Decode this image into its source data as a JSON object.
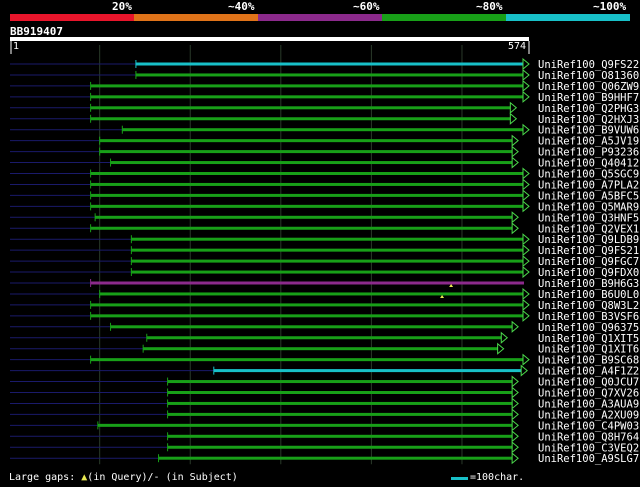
{
  "query": {
    "id": "BB919407",
    "start": "1",
    "end": "574",
    "length": 574
  },
  "identity_legend": [
    {
      "label": "20%",
      "color": "#e8152b"
    },
    {
      "label": "~40%",
      "color": "#e07319"
    },
    {
      "label": "~60%",
      "color": "#8c2a8c"
    },
    {
      "label": "~80%",
      "color": "#18a018"
    },
    {
      "label": "~100%",
      "color": "#18c0c8"
    }
  ],
  "hits": [
    {
      "name": "UniRef100_Q9FS22",
      "start": 140,
      "end": 574,
      "color": "#18c0c8",
      "dashed_to": 140,
      "end_marker": true
    },
    {
      "name": "UniRef100_O81360",
      "start": 140,
      "end": 574,
      "color": "#18a018",
      "dashed_to": 140,
      "end_marker": true
    },
    {
      "name": "UniRef100_Q06ZW9",
      "start": 90,
      "end": 574,
      "color": "#18a018",
      "dashed_to": 90,
      "end_marker": true
    },
    {
      "name": "UniRef100_B9HHF7",
      "start": 90,
      "end": 574,
      "color": "#18a018",
      "dashed_to": 90,
      "end_marker": true
    },
    {
      "name": "UniRef100_Q2PHG3",
      "start": 90,
      "end": 560,
      "color": "#18a018",
      "dashed_to": 90,
      "end_marker": true
    },
    {
      "name": "UniRef100_Q2HXJ3",
      "start": 90,
      "end": 560,
      "color": "#18a018",
      "dashed_to": 90,
      "end_marker": true
    },
    {
      "name": "UniRef100_B9VUW6",
      "start": 125,
      "end": 574,
      "color": "#18a018",
      "dashed_to": 125,
      "end_marker": true
    },
    {
      "name": "UniRef100_A5JV19",
      "start": 100,
      "end": 562,
      "color": "#18a018",
      "dashed_to": 100,
      "end_marker": true
    },
    {
      "name": "UniRef100_P93236",
      "start": 100,
      "end": 562,
      "color": "#18a018",
      "dashed_to": 100,
      "end_marker": true
    },
    {
      "name": "UniRef100_Q40412",
      "start": 112,
      "end": 562,
      "color": "#18a018",
      "dashed_to": 112,
      "end_marker": true
    },
    {
      "name": "UniRef100_Q5SGC9",
      "start": 90,
      "end": 574,
      "color": "#18a018",
      "dashed_to": 90,
      "end_marker": true
    },
    {
      "name": "UniRef100_A7PLA2",
      "start": 90,
      "end": 574,
      "color": "#18a018",
      "dashed_to": 90,
      "end_marker": true
    },
    {
      "name": "UniRef100_A5BFC5",
      "start": 90,
      "end": 574,
      "color": "#18a018",
      "dashed_to": 90,
      "end_marker": true
    },
    {
      "name": "UniRef100_Q5MAR9",
      "start": 90,
      "end": 574,
      "color": "#18a018",
      "dashed_to": 90,
      "end_marker": true
    },
    {
      "name": "UniRef100_Q3HNF5",
      "start": 95,
      "end": 562,
      "color": "#18a018",
      "dashed_to": 95,
      "end_marker": true
    },
    {
      "name": "UniRef100_Q2VEX1",
      "start": 90,
      "end": 562,
      "color": "#18a018",
      "dashed_to": 90,
      "end_marker": true
    },
    {
      "name": "UniRef100_Q9LDB9",
      "start": 135,
      "end": 574,
      "color": "#18a018",
      "dashed_to": 135,
      "end_marker": true
    },
    {
      "name": "UniRef100_Q9FS21",
      "start": 135,
      "end": 574,
      "color": "#18a018",
      "dashed_to": 135,
      "end_marker": true
    },
    {
      "name": "UniRef100_Q9FGC7",
      "start": 135,
      "end": 574,
      "color": "#18a018",
      "dashed_to": 135,
      "end_marker": true
    },
    {
      "name": "UniRef100_Q9FDX0",
      "start": 135,
      "end": 574,
      "color": "#18a018",
      "dashed_to": 135,
      "end_marker": true
    },
    {
      "name": "UniRef100_B9H6G3",
      "start": 90,
      "end": 574,
      "color": "#8c2a8c",
      "dashed_to": 90,
      "end_marker": false,
      "gap_marker_at": 488
    },
    {
      "name": "UniRef100_B6U0L0",
      "start": 100,
      "end": 574,
      "color": "#18a018",
      "dashed_to": 100,
      "end_marker": true,
      "gap_marker_at": 478
    },
    {
      "name": "UniRef100_Q8W3L2",
      "start": 90,
      "end": 574,
      "color": "#18a018",
      "dashed_to": 90,
      "end_marker": true
    },
    {
      "name": "UniRef100_B3VSF6",
      "start": 90,
      "end": 574,
      "color": "#18a018",
      "dashed_to": 90,
      "end_marker": true
    },
    {
      "name": "UniRef100_Q96375",
      "start": 112,
      "end": 562,
      "color": "#18a018",
      "dashed_to": 112,
      "end_marker": true
    },
    {
      "name": "UniRef100_Q1XIT5",
      "start": 152,
      "end": 550,
      "color": "#18a018",
      "dashed_to": 152,
      "end_marker": true
    },
    {
      "name": "UniRef100_Q1XIT6",
      "start": 148,
      "end": 546,
      "color": "#18a018",
      "dashed_to": 148,
      "end_marker": true
    },
    {
      "name": "UniRef100_B9SC68",
      "start": 90,
      "end": 574,
      "color": "#18a018",
      "dashed_to": 90,
      "end_marker": true
    },
    {
      "name": "UniRef100_A4F1Z2",
      "start": 226,
      "end": 572,
      "color": "#18c0c8",
      "dashed_to": 226,
      "end_marker": true
    },
    {
      "name": "UniRef100_Q0JCU7",
      "start": 175,
      "end": 562,
      "color": "#18a018",
      "dashed_to": 175,
      "end_marker": true
    },
    {
      "name": "UniRef100_Q7XV26",
      "start": 175,
      "end": 562,
      "color": "#18a018",
      "dashed_to": 175,
      "end_marker": true
    },
    {
      "name": "UniRef100_A3AUA9",
      "start": 175,
      "end": 562,
      "color": "#18a018",
      "dashed_to": 175,
      "end_marker": true
    },
    {
      "name": "UniRef100_A2XU09",
      "start": 175,
      "end": 562,
      "color": "#18a018",
      "dashed_to": 175,
      "end_marker": true
    },
    {
      "name": "UniRef100_C4PW03",
      "start": 98,
      "end": 562,
      "color": "#18a018",
      "dashed_to": 98,
      "end_marker": true
    },
    {
      "name": "UniRef100_Q8H764",
      "start": 175,
      "end": 562,
      "color": "#18a018",
      "dashed_to": 175,
      "end_marker": true
    },
    {
      "name": "UniRef100_C3VEQ2",
      "start": 175,
      "end": 562,
      "color": "#18a018",
      "dashed_to": 175,
      "end_marker": true
    },
    {
      "name": "UniRef100_A9SLG7",
      "start": 165,
      "end": 562,
      "color": "#18a018",
      "dashed_to": 165,
      "end_marker": true
    }
  ],
  "footer": {
    "gaps_text": "Large gaps:",
    "in_query_text": "(in Query)/",
    "in_subject_text": "- (in Subject)",
    "scale_text": "=100char."
  },
  "colors": {
    "background": "#000000",
    "grid": "#2a3a2a",
    "dashed_line": "#1a1a6a",
    "query_bar": "#ffffff"
  }
}
